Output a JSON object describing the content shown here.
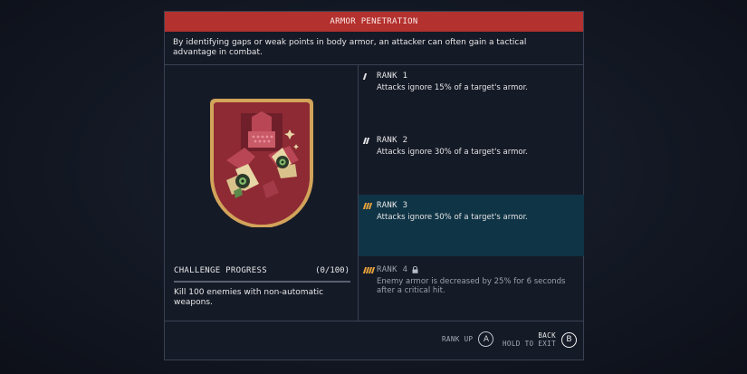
{
  "skill": {
    "title": "ARMOR PENETRATION",
    "description": "By identifying gaps or weak points in body armor, an attacker can often gain a tactical advantage in combat."
  },
  "challenge": {
    "title": "CHALLENGE PROGRESS",
    "count": "(0/100)",
    "description": "Kill 100 enemies with non-automatic weapons."
  },
  "ranks": [
    {
      "label": "RANK 1",
      "text": "Attacks ignore 15% of a target's armor.",
      "state": "unlocked"
    },
    {
      "label": "RANK 2",
      "text": "Attacks ignore 30% of a target's armor.",
      "state": "unlocked"
    },
    {
      "label": "RANK 3",
      "text": "Attacks ignore 50% of a target's armor.",
      "state": "selected"
    },
    {
      "label": "RANK 4",
      "text": "Enemy armor is decreased by 25% for 6 seconds after a critical hit.",
      "state": "locked"
    }
  ],
  "footer": {
    "rank_up_label": "RANK UP",
    "rank_up_key": "A",
    "back_label": "BACK",
    "back_sub_label": "HOLD TO EXIT",
    "back_key": "B"
  },
  "colors": {
    "title_bar": "#b3312f",
    "selected_rank_bg": "#0f3446",
    "rank_marker": "#e7a23a"
  },
  "icons": {
    "skill_badge": "armor-penetration-badge-icon",
    "rank_4_lock": "lock-icon"
  }
}
